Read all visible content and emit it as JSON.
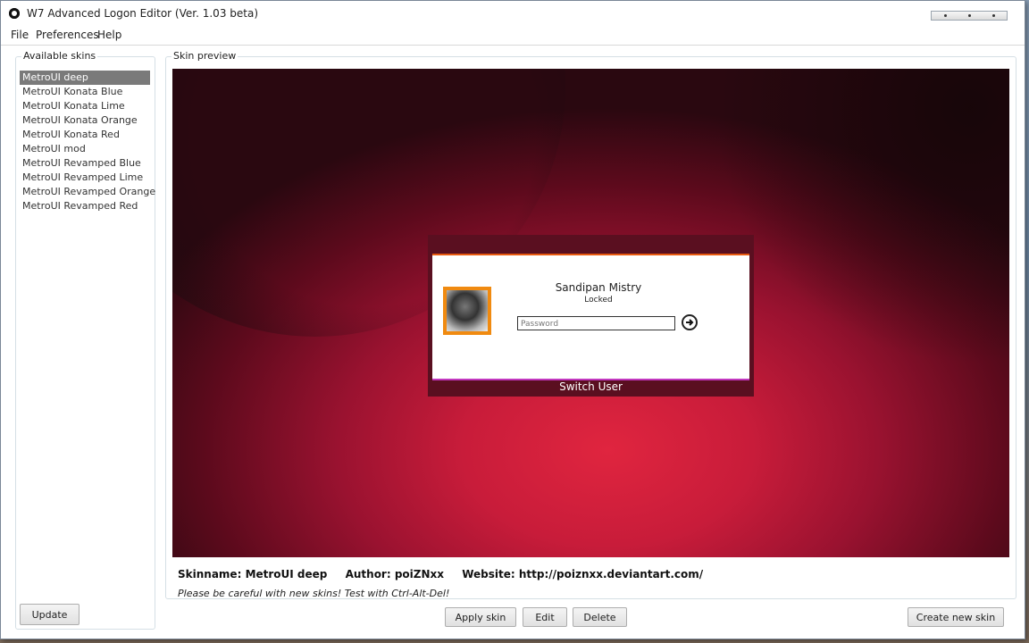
{
  "window": {
    "title": "W7 Advanced Logon Editor (Ver. 1.03 beta)"
  },
  "menu": {
    "items": [
      "File",
      "Preferences",
      "Help"
    ]
  },
  "skins_panel": {
    "title": "Available skins",
    "items": [
      "MetroUI deep",
      "MetroUI Konata Blue",
      "MetroUI Konata Lime",
      "MetroUI Konata Orange",
      "MetroUI Konata Red",
      "MetroUI mod",
      "MetroUI Revamped Blue",
      "MetroUI Revamped Lime",
      "MetroUI Revamped Orange",
      "MetroUI Revamped Red"
    ],
    "selected_index": 0,
    "update_button": "Update"
  },
  "preview_panel": {
    "title": "Skin preview",
    "logon": {
      "username": "Sandipan Mistry",
      "status": "Locked",
      "password_placeholder": "Password",
      "switch_user": "Switch User"
    },
    "info": {
      "skinname_label": "Skinname:",
      "skinname_value": "MetroUI deep",
      "author_label": "Author:",
      "author_value": "poiZNxx",
      "website_label": "Website:",
      "website_value": "http://poiznxx.deviantart.com/"
    },
    "warning": "Please be careful with new skins! Test with Ctrl-Alt-Del!"
  },
  "actions": {
    "apply": "Apply skin",
    "edit": "Edit",
    "delete": "Delete",
    "create": "Create new skin"
  },
  "colors": {
    "selected_row": "#7a7a7a",
    "avatar_border": "#f08a10",
    "logon_frame": "#5a0f20",
    "background_red": "#c81c3a"
  }
}
